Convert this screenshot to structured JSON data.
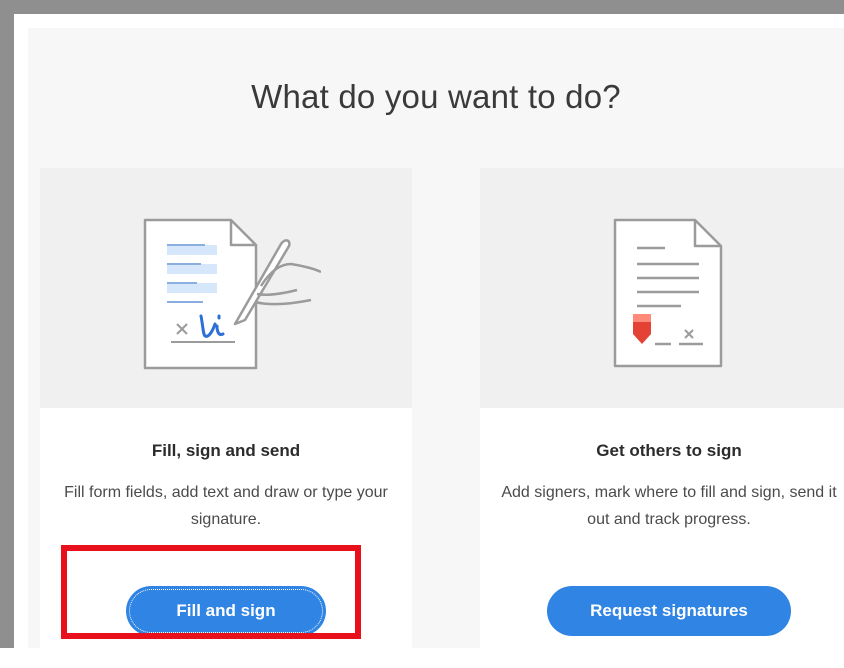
{
  "dialog": {
    "heading": "What do you want to do?"
  },
  "cards": [
    {
      "title": "Fill, sign and send",
      "description": "Fill form fields, add text and draw or type your signature.",
      "button_label": "Fill and sign",
      "illustration_icon": "fill-sign-document-icon"
    },
    {
      "title": "Get others to sign",
      "description": "Add signers, mark where to fill and sign, send it out and track progress.",
      "button_label": "Request signatures",
      "illustration_icon": "request-signatures-document-icon"
    }
  ],
  "annotation": {
    "highlight_color": "#e8101a",
    "highlighted_target": "fill-and-sign-button"
  },
  "colors": {
    "button": "#2f84e4",
    "accent_blue": "#2c6fd6",
    "marker_red": "#e34234"
  }
}
